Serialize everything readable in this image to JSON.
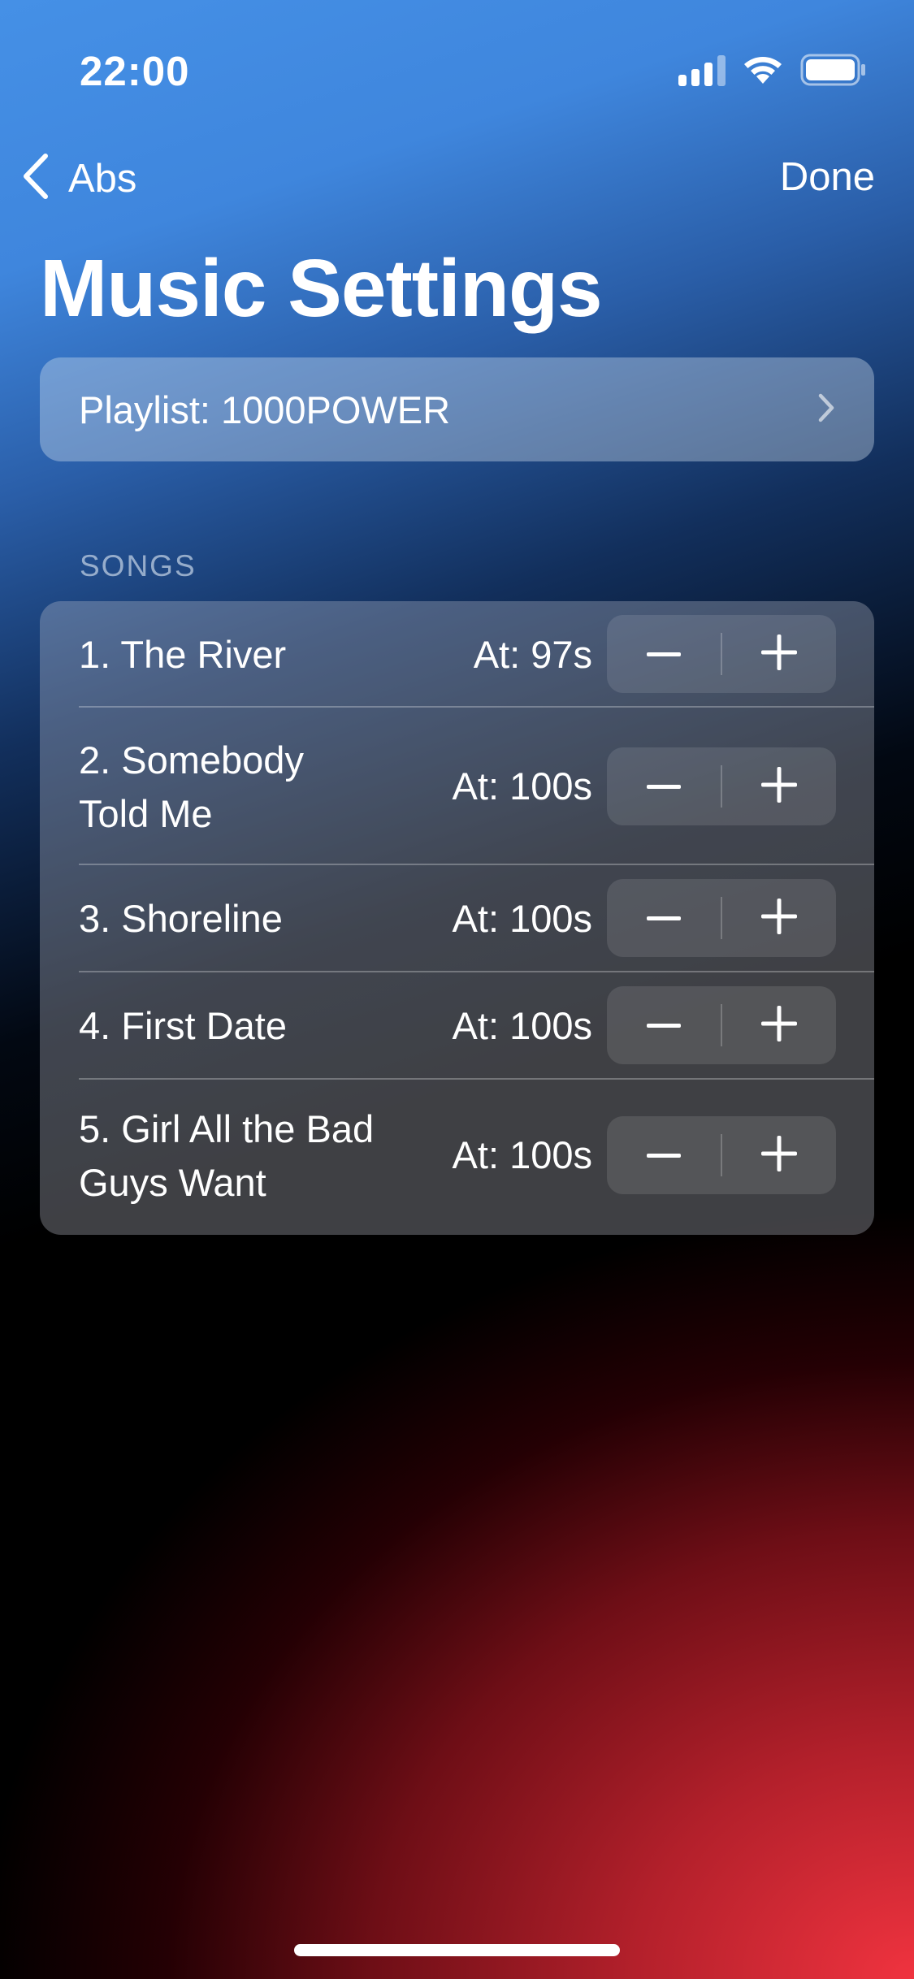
{
  "status_bar": {
    "time": "22:00",
    "signal_icon": "cellular-signal-icon",
    "wifi_icon": "wifi-icon",
    "battery_icon": "battery-full-icon"
  },
  "nav": {
    "back_label": "Abs",
    "back_icon": "chevron-left-icon",
    "done_label": "Done"
  },
  "page": {
    "title": "Music Settings"
  },
  "playlist": {
    "label": "Playlist: 1000POWER",
    "icon": "chevron-right-icon"
  },
  "songs_section": {
    "header": "SONGS",
    "items": [
      {
        "title": "1. The River",
        "time": "At: 97s"
      },
      {
        "title": "2. Somebody Told Me",
        "time": "At: 100s"
      },
      {
        "title": "3. Shoreline",
        "time": "At: 100s"
      },
      {
        "title": "4. First Date",
        "time": "At: 100s"
      },
      {
        "title": "5. Girl All the Bad Guys Want",
        "time": "At: 100s"
      }
    ],
    "decrement_icon": "minus-icon",
    "increment_icon": "plus-icon"
  },
  "colors": {
    "gradient_top": "#4590e6",
    "gradient_bottom": "#f0333f",
    "text": "#ffffff"
  }
}
